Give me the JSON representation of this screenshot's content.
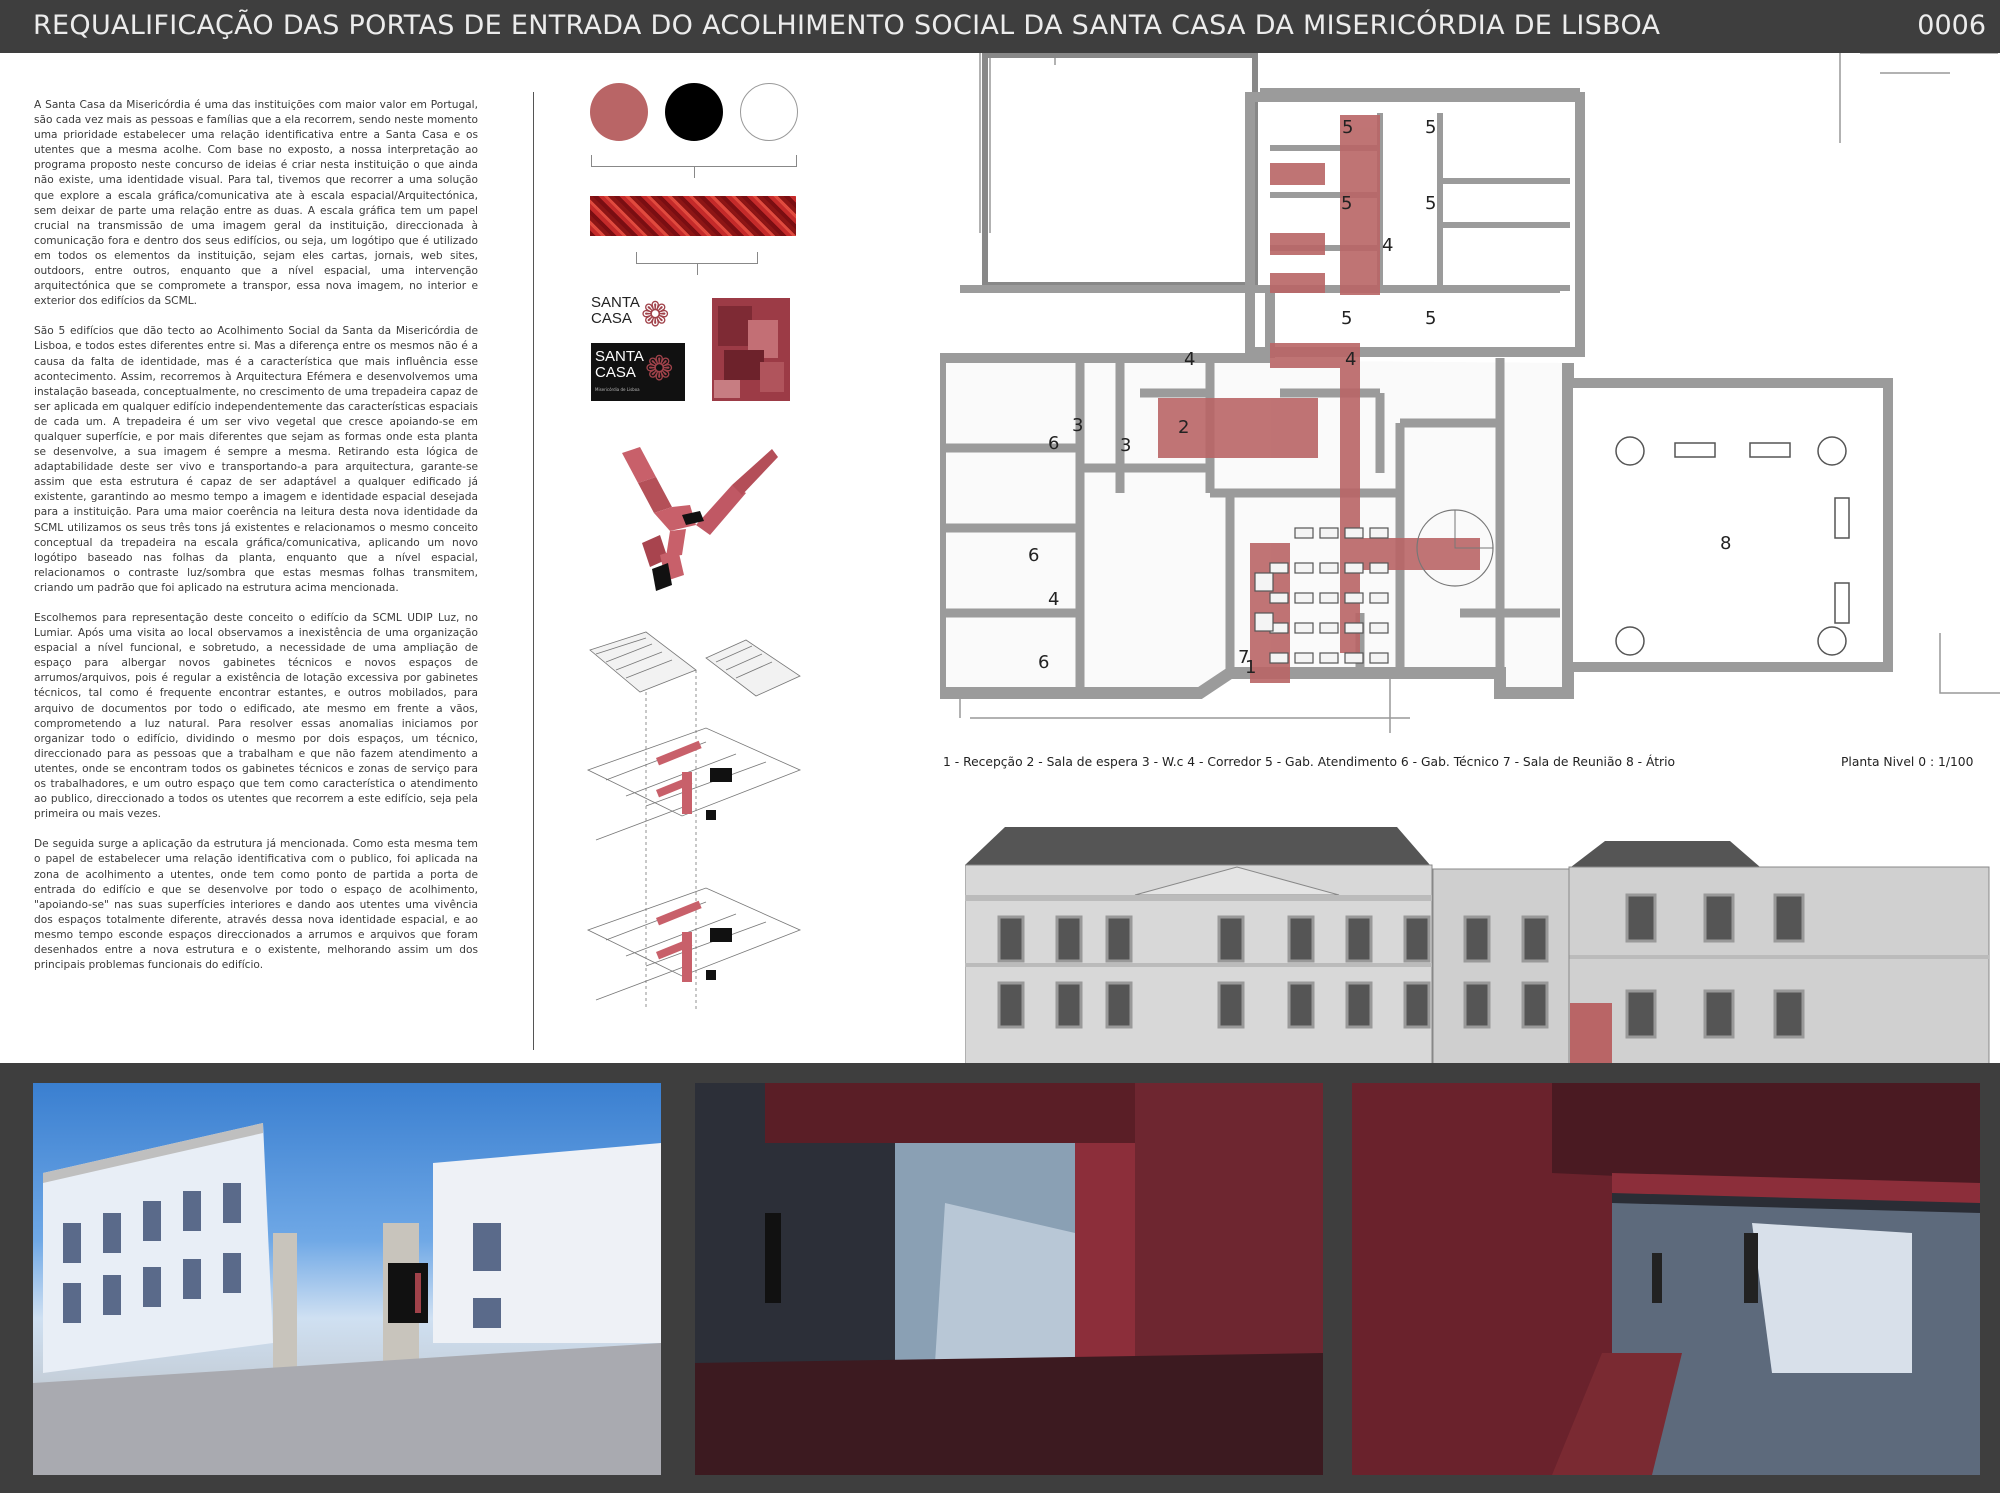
{
  "header": {
    "title": "REQUALIFICAÇÃO DAS PORTAS DE ENTRADA DO ACOLHIMENTO SOCIAL  DA SANTA CASA DA MISERICÓRDIA DE LISBOA",
    "sheet_number": "0006"
  },
  "text": {
    "p1": "A Santa Casa da Misericórdia é uma das instituições com maior valor em Portugal, são cada vez mais as pessoas e famílias que a ela recorrem, sendo neste momento uma prioridade estabelecer uma relação identificativa entre a Santa Casa e os utentes que a mesma acolhe. Com base no exposto, a nossa interpretação ao programa proposto neste concurso de ideias é criar nesta instituição o que ainda não existe, uma identidade visual. Para tal, tivemos que recorrer a uma solução que explore a escala gráfica/comunicativa ate à escala espacial/Arquitectónica, sem deixar de parte uma relação entre as duas. A escala gráfica tem um papel crucial na transmissão de uma imagem geral da instituição, direccionada à comunicação fora e dentro dos seus edifícios, ou seja, um logótipo que é utilizado em todos os elementos da instituição, sejam eles cartas, jornais, web sites, outdoors, entre outros, enquanto que a nível espacial, uma intervenção arquitectónica que se compromete a transpor, essa nova imagem, no interior e exterior dos edifícios da SCML.",
    "p2": "São 5 edifícios que dão tecto ao Acolhimento Social da Santa da Misericórdia de Lisboa, e todos estes diferentes entre si. Mas a diferença entre os mesmos não é a causa da falta de identidade, mas é a característica que mais influência esse acontecimento. Assim, recorremos à Arquitectura Efémera e desenvolvemos uma instalação baseada, conceptualmente, no crescimento de uma trepadeira capaz de ser aplicada em qualquer edifício independentemente das características espaciais de cada um. A trepadeira é um ser vivo vegetal que cresce apoiando-se em qualquer superfície, e por mais diferentes que sejam as formas onde esta planta se desenvolve, a sua imagem é sempre a mesma. Retirando esta lógica de adaptabilidade deste ser vivo e transportando-a para arquitectura, garante-se assim que esta estrutura é capaz de ser adaptável a qualquer edificado já existente, garantindo ao mesmo tempo a imagem e identidade espacial desejada para a instituição. Para uma maior coerência na leitura desta nova identidade da SCML utilizamos os seus três tons já existentes e relacionamos o mesmo conceito conceptual da trepadeira na escala gráfica/comunicativa, aplicando um novo logótipo baseado nas folhas da planta, enquanto que a nível espacial, relacionamos o contraste luz/sombra que estas mesmas folhas transmitem, criando um padrão que foi aplicado na estrutura acima mencionada.",
    "p3": "Escolhemos para representação deste conceito o edifício da SCML UDIP Luz, no Lumiar. Após uma visita ao local observamos a inexistência de uma organização espacial a nível funcional, e sobretudo, a necessidade de uma ampliação de espaço para albergar novos gabinetes técnicos e novos espaços de arrumos/arquivos, pois é regular a existência de lotação excessiva por gabinetes técnicos, tal como é frequente encontrar estantes, e outros mobilados, para arquivo de documentos por todo o edificado, ate mesmo em frente a vãos, comprometendo a luz natural. Para resolver essas anomalias iniciamos por organizar todo o edifício, dividindo o mesmo por dois espaços, um técnico, direccionado para as pessoas que a trabalham e que não fazem atendimento a utentes, onde se encontram todos os gabinetes técnicos e zonas de serviço para os trabalhadores, e um outro espaço que tem como característica o atendimento ao publico, direccionado a todos os utentes que recorrem a este edifício, seja pela primeira ou mais vezes.",
    "p4": "De seguida surge a aplicação da estrutura já mencionada. Como esta mesma tem o papel de estabelecer uma relação identificativa com o publico, foi aplicada na zona de acolhimento a utentes, onde tem como ponto de partida a porta de entrada do edifício e que se desenvolve por todo o espaço de acolhimento, \"apoiando-se\" nas suas superfícies interiores e dando aos utentes uma vivência dos espaços totalmente diferente, através dessa nova identidade espacial, e ao mesmo tempo esconde espaços direccionados a arrumos e arquivos que foram desenhados entre a nova estrutura e o existente, melhorando assim um dos principais problemas funcionais do edifício."
  },
  "palette": [
    "#b96566",
    "#000000",
    "#ffffff"
  ],
  "logo": {
    "line1": "SANTA",
    "line2": "CASA",
    "subtitle": "Misericórdia de Lisboa"
  },
  "plan": {
    "room_labels": [
      "1",
      "2",
      "3",
      "3",
      "4",
      "4",
      "4",
      "4",
      "5",
      "5",
      "5",
      "5",
      "5",
      "5",
      "6",
      "6",
      "6",
      "7",
      "8"
    ],
    "legend": "1 - Recepção   2 - Sala de espera   3 - W.c   4 - Corredor   5 - Gab. Atendimento   6 - Gab. Técnico   7 - Sala de Reunião   8 - Átrio",
    "scale_label": "Planta Nivel 0 : 1/100"
  },
  "colors": {
    "accent": "#b96566",
    "accent_dark": "#7d2e36",
    "bar": "#3e3e3e",
    "wall": "#9b9b9b"
  }
}
